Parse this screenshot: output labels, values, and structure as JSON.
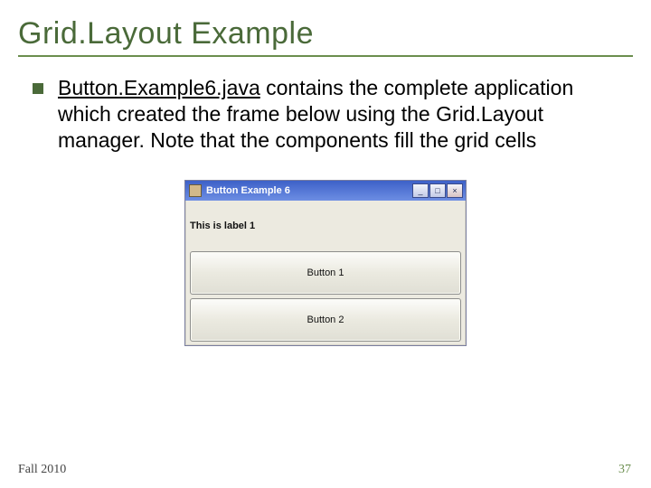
{
  "title": "Grid.Layout Example",
  "bullet": {
    "link_text": "Button.Example6.java",
    "rest_text": " contains the complete application which created the frame below using the Grid.Layout manager.  Note that the components fill the grid cells"
  },
  "window": {
    "title": "Button Example 6",
    "label_text": "This is label 1",
    "button1_text": "Button 1",
    "button2_text": "Button 2",
    "min_glyph": "_",
    "max_glyph": "□",
    "close_glyph": "×"
  },
  "footer": {
    "term": "Fall 2010",
    "page": "37"
  }
}
